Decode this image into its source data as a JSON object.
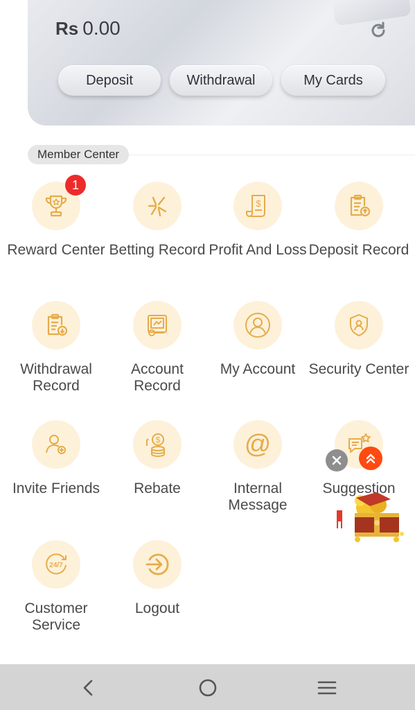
{
  "wallet": {
    "currency": "Rs",
    "balance": "0.00",
    "buttons": [
      "Deposit",
      "Withdrawal",
      "My Cards"
    ]
  },
  "section": {
    "title": "Member Center"
  },
  "menu": [
    {
      "label": "Reward Center",
      "icon": "trophy-icon",
      "badge": "1"
    },
    {
      "label": "Betting Record",
      "icon": "star-burst-icon"
    },
    {
      "label": "Profit And Loss",
      "icon": "dollar-receipt-icon"
    },
    {
      "label": "Deposit Record",
      "icon": "clipboard-upload-icon"
    },
    {
      "label": "Withdrawal Record",
      "icon": "clipboard-download-icon"
    },
    {
      "label": "Account Record",
      "icon": "monitor-record-icon"
    },
    {
      "label": "My Account",
      "icon": "user-circle-icon"
    },
    {
      "label": "Security Center",
      "icon": "shield-user-icon"
    },
    {
      "label": "Invite Friends",
      "icon": "user-add-icon"
    },
    {
      "label": "Rebate",
      "icon": "coin-stack-icon"
    },
    {
      "label": "Internal Message",
      "icon": "at-sign-icon"
    },
    {
      "label": "Suggestion",
      "icon": "chat-star-icon"
    },
    {
      "label": "Customer Service",
      "icon": "support-24-7-icon"
    },
    {
      "label": "Logout",
      "icon": "logout-arrow-icon"
    }
  ],
  "colors": {
    "accent": "#e6ac4a",
    "icon_bg": "#fdf1da",
    "badge": "#ee2b2b",
    "float_up": "#ff4a12"
  }
}
